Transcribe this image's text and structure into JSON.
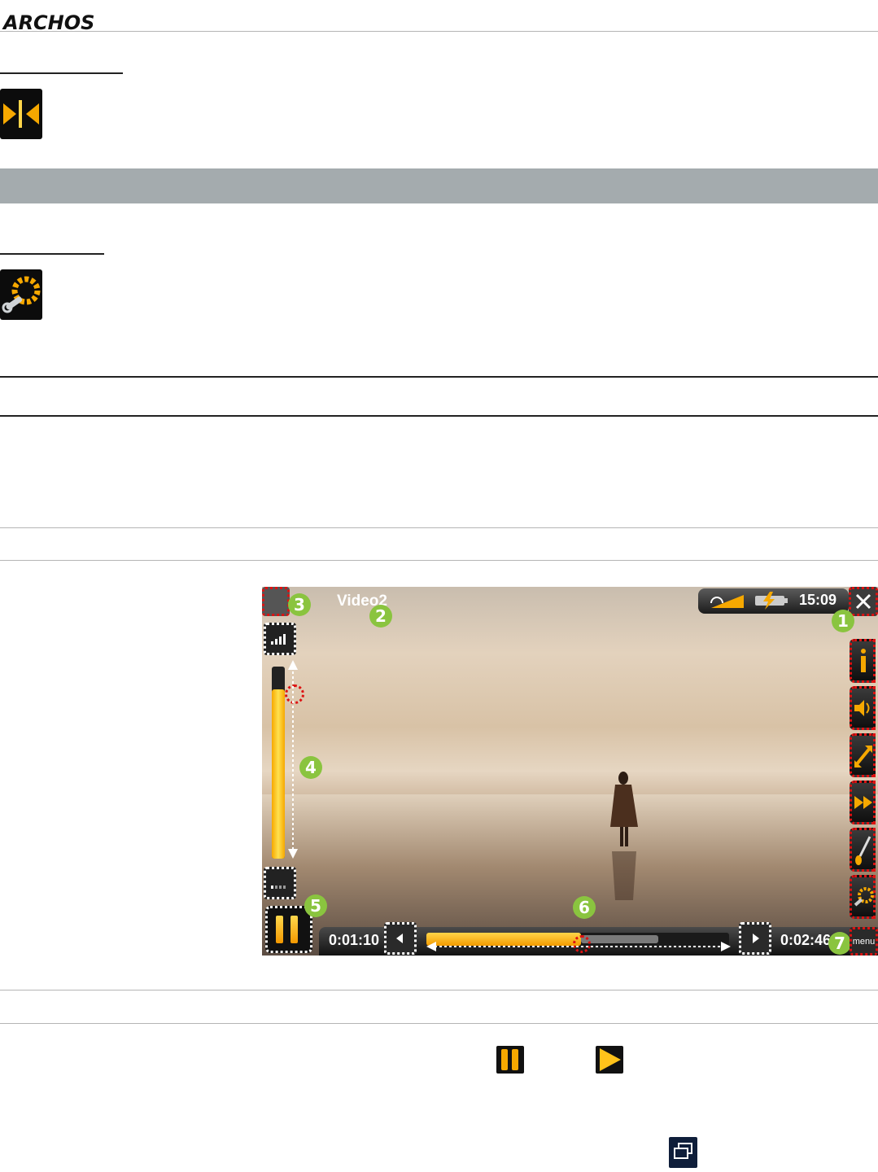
{
  "header": {
    "logo_text": "ARCHOS"
  },
  "icons": {
    "top_icon": "ab-repeat-icon",
    "settings_icon": "wrench-gear-icon",
    "pause_inline_icon": "pause-icon",
    "play_inline_icon": "play-icon",
    "window_inline_icon": "window-switch-icon"
  },
  "player": {
    "video_title": "Video2",
    "clock": "15:09",
    "elapsed_time": "0:01:10",
    "total_time": "0:02:46",
    "menu_label": "menu",
    "progress_fraction": 0.51,
    "volume_fraction": 0.88,
    "callouts": [
      "1",
      "2",
      "3",
      "4",
      "5",
      "6",
      "7"
    ],
    "side_buttons": [
      "info-icon",
      "speaker-icon",
      "resize-icon",
      "fast-forward-icon",
      "paintbrush-icon",
      "settings-icon"
    ]
  },
  "colors": {
    "accent_orange": "#f39b00",
    "accent_yellow": "#ffd54a",
    "callout_green": "#8ac43f",
    "band_gray": "#a4abae",
    "highlight_red": "#dd1111"
  }
}
